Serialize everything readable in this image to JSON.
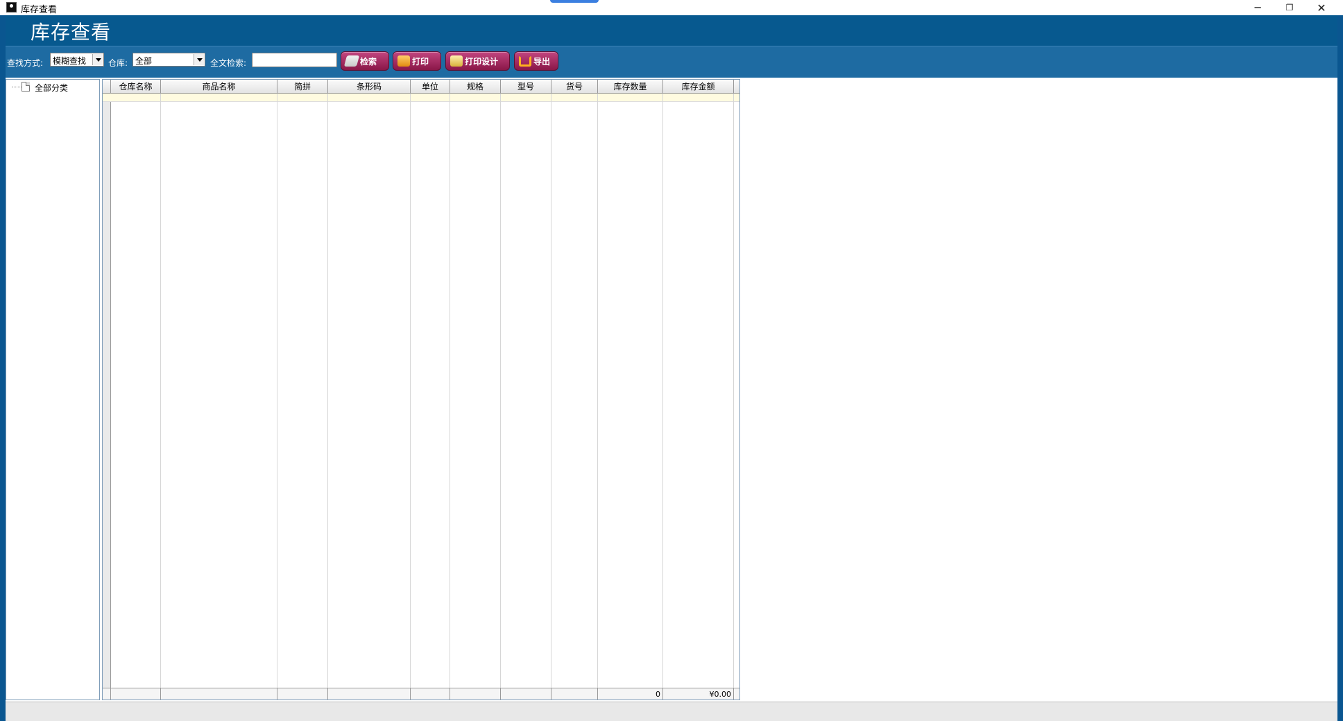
{
  "window": {
    "title": "库存查看",
    "minimize_glyph": "─",
    "maximize_glyph": "❐",
    "close_glyph": "✕"
  },
  "header": {
    "title": "库存查看"
  },
  "toolbar": {
    "search_mode_label": "查找方式:",
    "search_mode_value": "模糊查找",
    "warehouse_label": "仓库:",
    "warehouse_value": "全部",
    "fulltext_label": "全文检索:",
    "fulltext_value": "",
    "buttons": {
      "search": "检索",
      "print": "打印",
      "print_design": "打印设计",
      "export": "导出"
    }
  },
  "tree": {
    "root_label": "全部分类"
  },
  "grid": {
    "columns": [
      "仓库名称",
      "商品名称",
      "简拼",
      "条形码",
      "单位",
      "规格",
      "型号",
      "货号",
      "库存数量",
      "库存金额"
    ],
    "rows": [],
    "footer": {
      "quantity_total": "0",
      "amount_total": "¥0.00"
    }
  }
}
